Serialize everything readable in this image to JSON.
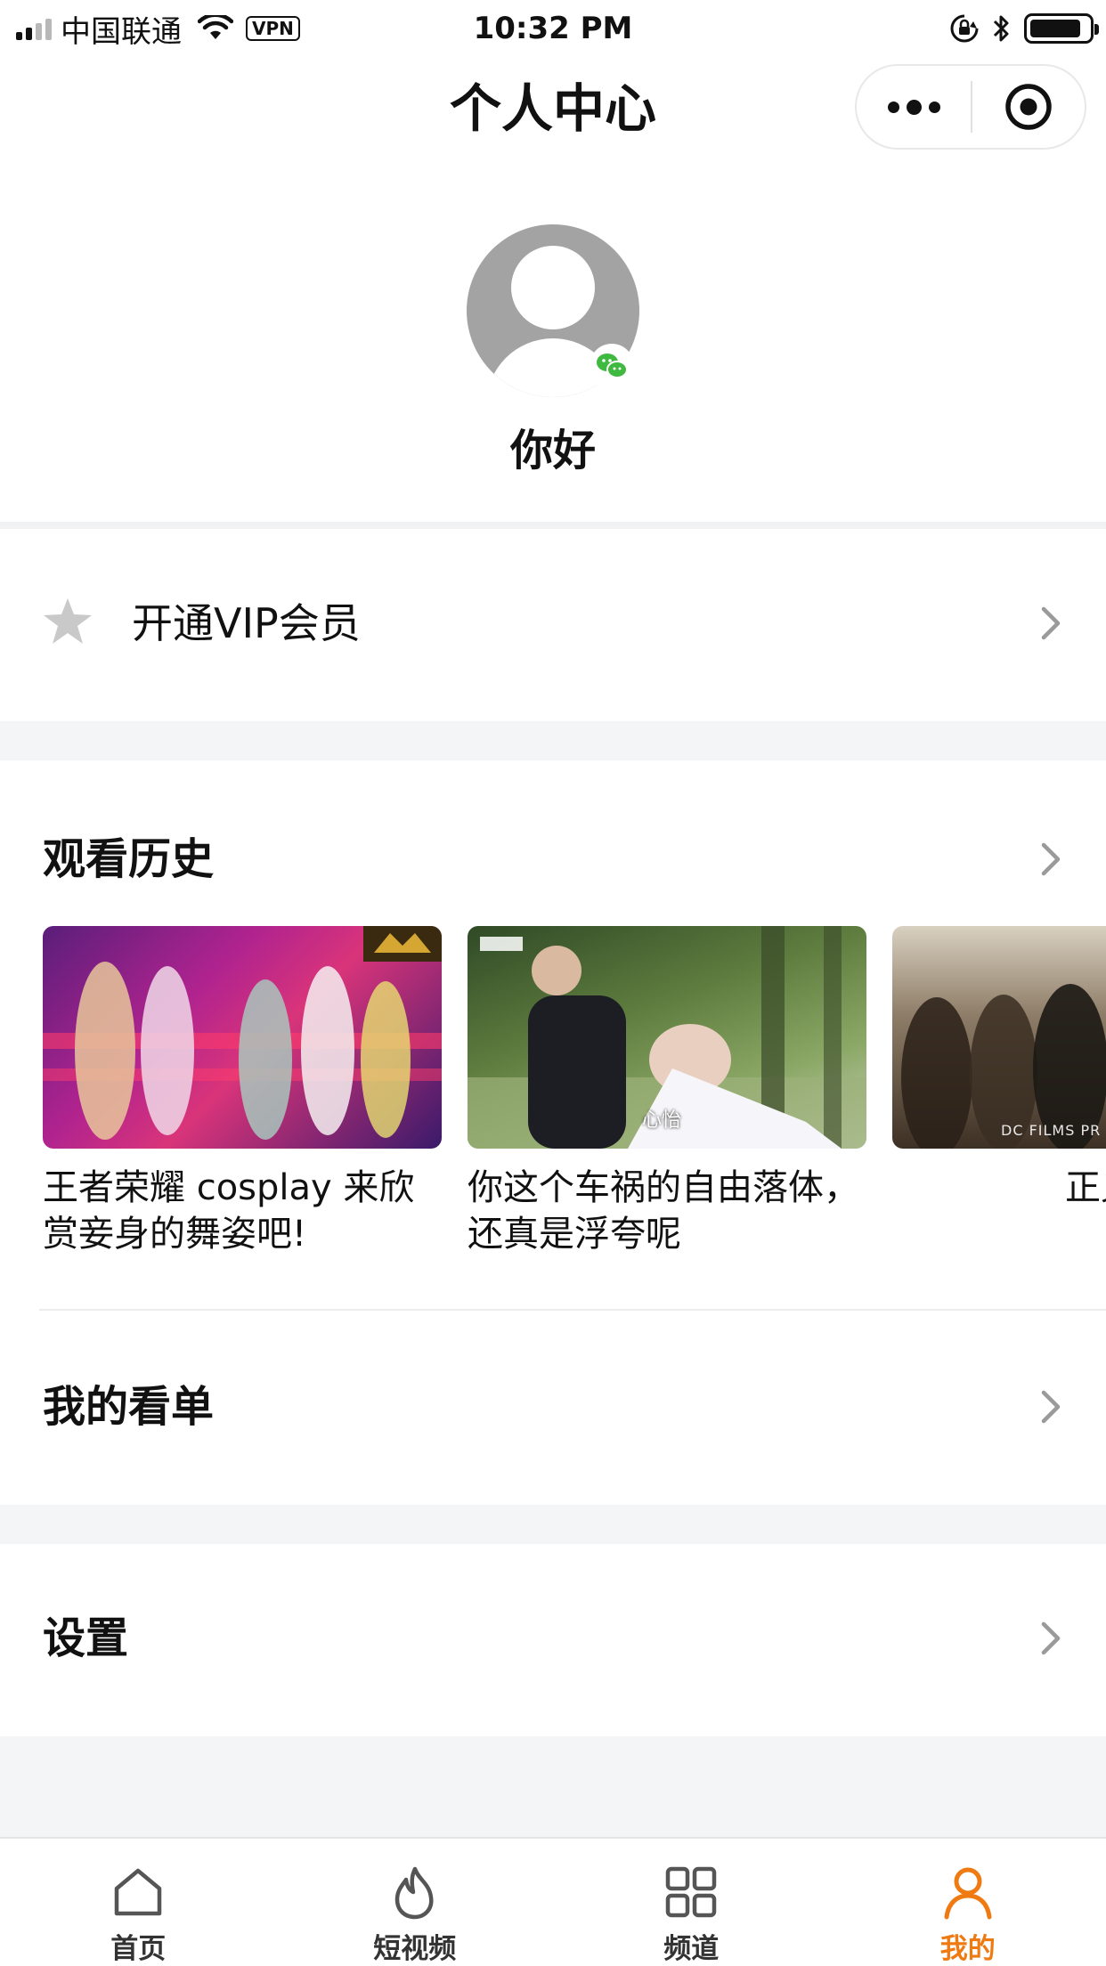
{
  "status_bar": {
    "carrier": "中国联通",
    "vpn": "VPN",
    "time": "10:32 PM"
  },
  "nav": {
    "title": "个人中心",
    "more_icon": "more-dots-icon",
    "close_icon": "close-circle-icon"
  },
  "profile": {
    "name": "你好",
    "avatar_icon": "default-avatar-icon",
    "badge_icon": "wechat-icon"
  },
  "vip": {
    "label": "开通VIP会员",
    "icon": "star-moon-icon"
  },
  "history": {
    "title": "观看历史",
    "items": [
      {
        "caption": "王者荣耀 cosplay 来欣赏妾身的舞姿吧!"
      },
      {
        "caption": "你这个车祸的自由落体，还真是浮夸呢",
        "overlay": "心怡"
      },
      {
        "caption": "正义联",
        "overlay": "DC FILMS PR"
      }
    ]
  },
  "watchlist": {
    "title": "我的看单"
  },
  "settings": {
    "title": "设置"
  },
  "tabbar": {
    "active_color": "#f07a12",
    "tabs": [
      {
        "label": "首页",
        "icon": "home-icon"
      },
      {
        "label": "短视频",
        "icon": "flame-icon"
      },
      {
        "label": "频道",
        "icon": "grid-icon"
      },
      {
        "label": "我的",
        "icon": "person-icon",
        "active": true
      }
    ]
  }
}
